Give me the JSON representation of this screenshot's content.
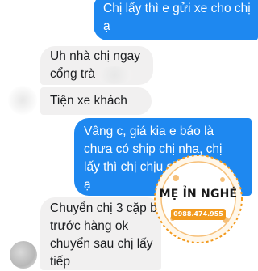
{
  "messages": [
    {
      "id": "msg1",
      "direction": "outgoing",
      "lines": [
        "Chị lấy thì e gửi xe cho chị",
        "ạ"
      ]
    },
    {
      "id": "msg2",
      "direction": "incoming",
      "lines": [
        "Uh nhà chị ngay",
        "cổng trà"
      ]
    },
    {
      "id": "msg3",
      "direction": "incoming",
      "lines": [
        "Tiện xe khách"
      ]
    },
    {
      "id": "msg4",
      "direction": "outgoing",
      "lines": [
        "Vâng c, giá kia e báo là",
        "chưa có ship chị nha, chị",
        "lấy thì chị chịu ship giúp e",
        "ạ"
      ]
    },
    {
      "id": "msg5",
      "direction": "incoming",
      "lines": [
        "Chuyển chị 3 cặp bé",
        "trước hàng ok",
        "chuyển sau chị lấy",
        "tiếp"
      ]
    }
  ],
  "watermark": {
    "brand": "MẸ ỈN NGHÉ",
    "phone": "0988.474.955"
  },
  "colors": {
    "outgoing_bubble": "#1e88f0",
    "incoming_bubble": "#f1f0f0",
    "watermark_brand": "#1a1a1a",
    "watermark_accent": "#f29a1e"
  }
}
